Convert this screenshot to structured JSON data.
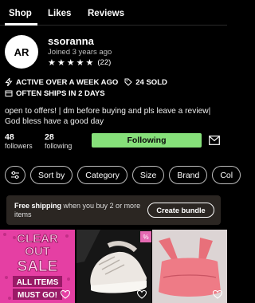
{
  "tabs": [
    "Shop",
    "Likes",
    "Reviews"
  ],
  "profile": {
    "initials": "AR",
    "username": "ssoranna",
    "joined": "Joined 3 years ago",
    "rating_count": "(22)",
    "stars": 5
  },
  "badges": {
    "active": "ACTIVE OVER A WEEK AGO",
    "sold": "24 SOLD",
    "ships": "OFTEN SHIPS IN 2 DAYS"
  },
  "bio": "open to offers! | dm before buying and pls leave a review| God bless have a good day",
  "stats": {
    "followers_count": "48",
    "followers_label": "followers",
    "following_count": "28",
    "following_label": "following"
  },
  "follow_button": "Following",
  "filters": [
    "Sort by",
    "Category",
    "Size",
    "Brand",
    "Col"
  ],
  "shipping": {
    "bold": "Free shipping",
    "rest": " when you buy 2 or more items",
    "button": "Create bundle"
  },
  "listings": {
    "clearout_sign": [
      "CLEAR",
      "OUT",
      "SALE",
      "ALL ITEMS",
      "MUST GO!"
    ],
    "tag": "%"
  },
  "colors": {
    "follow_green": "#86e07a",
    "shipping_bg": "#2b2622",
    "sale_pink": "#e53fa3"
  }
}
